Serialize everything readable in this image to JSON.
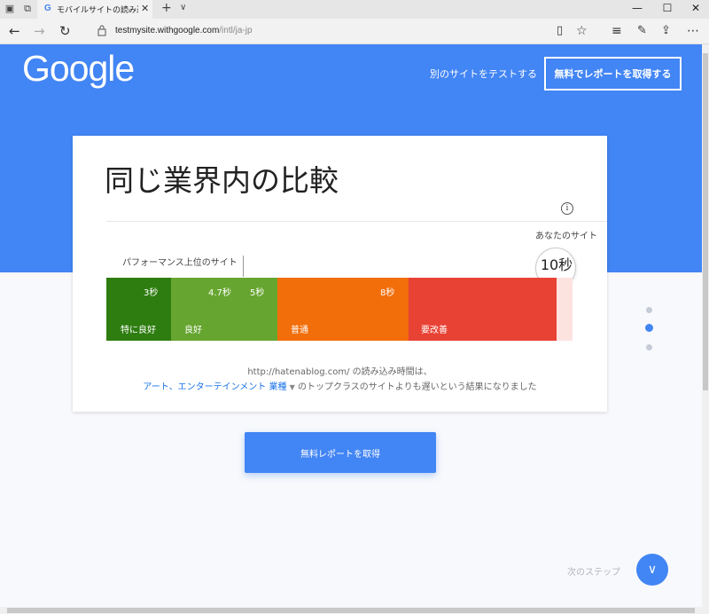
{
  "browser": {
    "tab_title": "モバイルサイトの読み込み速",
    "tab_favicon": "G",
    "url_host": "testmysite.withgoogle.com",
    "url_path": "/intl/ja-jp"
  },
  "header": {
    "logo": "Google",
    "test_other_link": "別のサイトをテストする",
    "get_report_button": "無料でレポートを取得する"
  },
  "card": {
    "title": "同じ業界内の比較",
    "your_site_label": "あなたのサイト",
    "your_site_value": "10秒",
    "top_sites_label": "パフォーマンス上位のサイト",
    "segments": [
      {
        "label": "特に良好",
        "value": "3秒",
        "color": "#2e7d10"
      },
      {
        "label": "良好",
        "value": "4.7秒",
        "value2": "5秒",
        "color": "#66a52f"
      },
      {
        "label": "普通",
        "value": "8秒",
        "color": "#f26e0a"
      },
      {
        "label": "要改善",
        "value": "",
        "color": "#e84234"
      }
    ],
    "result_line1": "http://hatenablog.com/ の読み込み時間は、",
    "category": "アート、エンターテインメント 業種",
    "result_line2_rest": "のトップクラスのサイトよりも遅いという結果になりました"
  },
  "cta_button": "無料レポートを取得",
  "next_step_label": "次のステップ",
  "colors": {
    "brand_blue": "#4285f4",
    "link_blue": "#1a73e8"
  }
}
